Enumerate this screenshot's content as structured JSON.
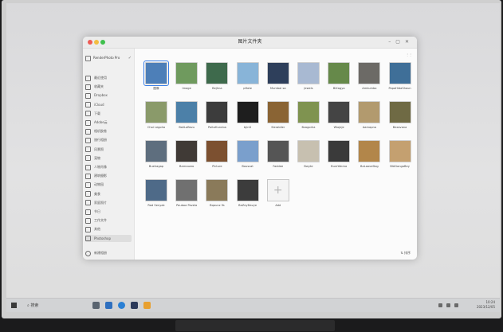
{
  "window": {
    "title": "图片文件夹"
  },
  "sidebar": {
    "header": "RenderPhoto Pro",
    "items": [
      {
        "label": "最近使用"
      },
      {
        "label": "收藏夹"
      },
      {
        "label": "Dropbox"
      },
      {
        "label": "iCloud"
      },
      {
        "label": "下载"
      },
      {
        "label": "Adobe云"
      },
      {
        "label": "相机胶卷"
      },
      {
        "label": "旅行相册"
      },
      {
        "label": "风景照"
      },
      {
        "label": "宠物"
      },
      {
        "label": "人物肖像"
      },
      {
        "label": "建筑摄影"
      },
      {
        "label": "动物园"
      },
      {
        "label": "美食"
      },
      {
        "label": "家庭照片"
      },
      {
        "label": "节日"
      },
      {
        "label": "工作文件"
      },
      {
        "label": "其他"
      },
      {
        "label": "Photoshop"
      }
    ],
    "footer": "新建相册"
  },
  "grid": {
    "items": [
      {
        "label": "图像",
        "color": "#4d7fb8"
      },
      {
        "label": "Image",
        "color": "#6f9a5e"
      },
      {
        "label": "Bejhna",
        "color": "#3e6a4c"
      },
      {
        "label": "pHote",
        "color": "#88b4d8"
      },
      {
        "label": "Mumbai sa",
        "color": "#2e3f5b"
      },
      {
        "label": "Jewels",
        "color": "#a8b9d2"
      },
      {
        "label": "BiXagyo",
        "color": "#66894a"
      },
      {
        "label": "Amkumbo",
        "color": "#6c6a66"
      },
      {
        "label": "PapaHidaShaun",
        "color": "#3f6f98"
      },
      {
        "label": "Choi Legoha",
        "color": "#8a9a6a"
      },
      {
        "label": "BaliLaBezu",
        "color": "#4c80a8"
      },
      {
        "label": "PoitaHunnba",
        "color": "#3c3c3c"
      },
      {
        "label": "bjinG",
        "color": "#1e1e1e"
      },
      {
        "label": "Slerabiler",
        "color": "#8a6434"
      },
      {
        "label": "Bzagorha",
        "color": "#7f9350"
      },
      {
        "label": "Wiojeje",
        "color": "#444444"
      },
      {
        "label": "Aamapna",
        "color": "#b29a6e"
      },
      {
        "label": "Bezavana",
        "color": "#6f6a44"
      },
      {
        "label": "Buehagap",
        "color": "#5e6e7e"
      },
      {
        "label": "Bamvoaro",
        "color": "#403a36"
      },
      {
        "label": "Picture",
        "color": "#7c5030"
      },
      {
        "label": "Bouscat",
        "color": "#7a9fcc"
      },
      {
        "label": "Faddee",
        "color": "#555555"
      },
      {
        "label": "Bwyte",
        "color": "#c7c0b0"
      },
      {
        "label": "BureYakma",
        "color": "#3a3a3a"
      },
      {
        "label": "BaLaaveDog",
        "color": "#b2864a"
      },
      {
        "label": "BIAGangaBey",
        "color": "#c4a070"
      },
      {
        "label": "Rad Senyak",
        "color": "#4e6a88"
      },
      {
        "label": "Pauboa Pavela",
        "color": "#707070"
      },
      {
        "label": "Bqaunz Ya",
        "color": "#8a7a5a"
      },
      {
        "label": "BaZeyDavye",
        "color": "#3c3c3c"
      },
      {
        "label": "Add",
        "color": "#f4f4f4"
      }
    ]
  },
  "status": {
    "text": "⇅ 排序"
  },
  "taskbar": {
    "search": "搜索",
    "time": "10:24",
    "date": "2023/12/05"
  },
  "colors": {
    "accent": "#3a7ee6",
    "titlebar": "#ececec"
  }
}
